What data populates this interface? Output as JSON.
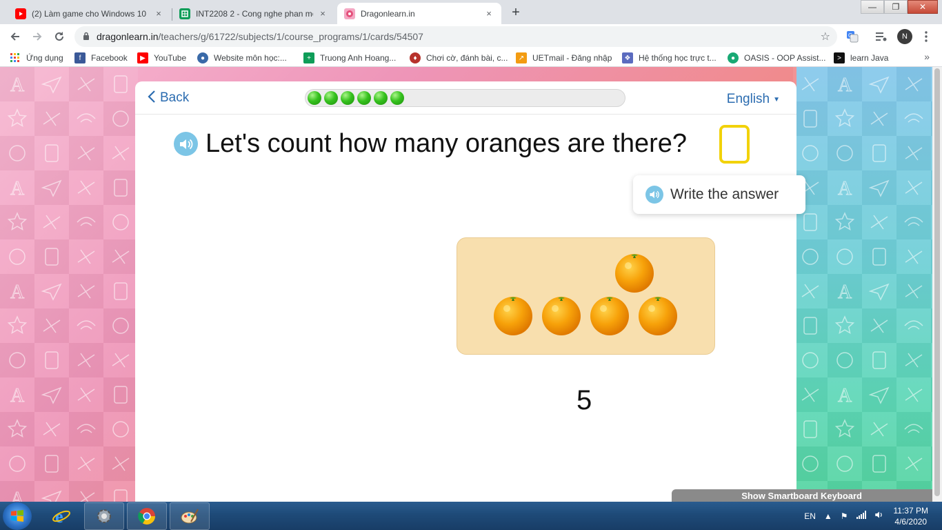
{
  "browser": {
    "tabs": [
      {
        "title": "(2) Làm game cho Windows 10 +",
        "icon": "youtube-icon",
        "active": false
      },
      {
        "title": "INT2208 2 - Cong nghe phan me",
        "icon": "sheets-icon",
        "active": false
      },
      {
        "title": "Dragonlearn.in",
        "icon": "dragonlearn-icon",
        "active": true
      }
    ],
    "close_glyph": "×",
    "new_tab_glyph": "+",
    "url_host": "dragonlearn.in",
    "url_path": "/teachers/g/61722/subjects/1/course_programs/1/cards/54507",
    "profile_initial": "N",
    "bookmarks": [
      {
        "label": "Ứng dụng",
        "icon": "apps-grid-icon"
      },
      {
        "label": "Facebook",
        "icon": "facebook-icon"
      },
      {
        "label": "YouTube",
        "icon": "youtube-icon"
      },
      {
        "label": "Website môn học:...",
        "icon": "globe-icon"
      },
      {
        "label": "Truong Anh Hoang...",
        "icon": "sheets-icon"
      },
      {
        "label": "Chơi cờ, đánh bài, c...",
        "icon": "game-icon"
      },
      {
        "label": "UETmail - Đăng nhập",
        "icon": "mail-icon"
      },
      {
        "label": "Hệ thống học trực t...",
        "icon": "learning-icon"
      },
      {
        "label": "OASIS - OOP Assist...",
        "icon": "oasis-icon"
      },
      {
        "label": "learn Java",
        "icon": "terminal-icon"
      }
    ],
    "bookmarks_more": "»"
  },
  "lesson": {
    "back_label": "Back",
    "language": "English",
    "progress_dots": 6,
    "question": "Let's count how many oranges are there?",
    "hint": "Write the answer",
    "oranges_count": 5,
    "number_label": "5",
    "smartboard_label": "Show Smartboard Keyboard"
  },
  "taskbar": {
    "apps": [
      "internet-explorer-icon",
      "control-panel-icon",
      "chrome-icon",
      "paint-icon"
    ],
    "language": "EN",
    "time": "11:37 PM",
    "date": "4/6/2020"
  },
  "colors": {
    "accent_blue": "#2b6cb0",
    "answer_box": "#f2d20a",
    "progress_green": "#36c21e",
    "tray": "#f8dfae"
  }
}
